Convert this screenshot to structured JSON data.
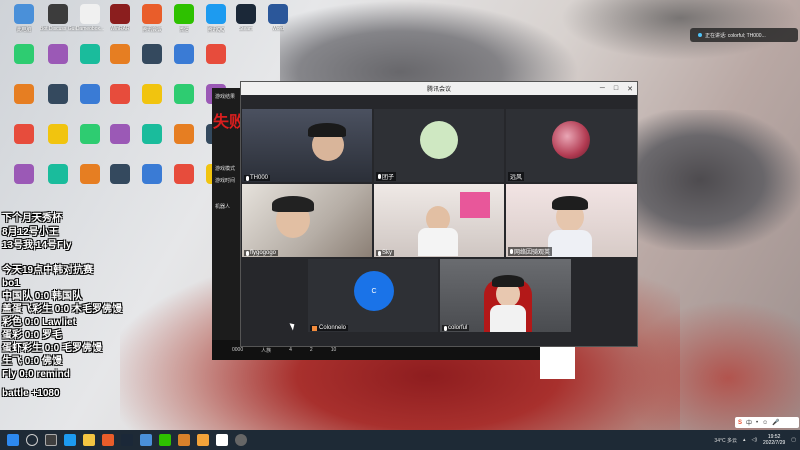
{
  "desktop_icons": [
    {
      "label": "此电脑",
      "color": "#4a90d9"
    },
    {
      "label": "Bot Discuss Guide...",
      "color": "#3c3c3c"
    },
    {
      "label": "Dameobox...",
      "color": "#f0f0f0"
    },
    {
      "label": "WinRAR",
      "color": "#8b1e1e"
    },
    {
      "label": "腾讯会议",
      "color": "#e95d2a"
    },
    {
      "label": "微信",
      "color": "#2ec100"
    },
    {
      "label": "腾讯QQ",
      "color": "#1d9bf0"
    },
    {
      "label": "Steam",
      "color": "#1b2838"
    },
    {
      "label": "Word",
      "color": "#2b579a"
    }
  ],
  "overlay": {
    "lines": [
      "下个月天秀杯",
      "8月12号小王",
      "13号我,14号Fly",
      "今天19点中韩对抗赛",
      "bo1",
      "中国队    0:0 韩国队",
      "盖蛋飞彩生 0:0 木毛罗佛馒",
      "彩色        0:0 Lawliet",
      "蛋彩        0:0 罗毛",
      "蛋虾彩生 0:0 毛罗佛馒",
      "生飞        0:0 佛馒",
      "Fly          0:0 remind",
      "battle +1080"
    ]
  },
  "game": {
    "fail_text": "失败",
    "side_items": [
      "游戏结果",
      "游戏模式",
      "游戏时间",
      "机器人"
    ],
    "bar_items": [
      "0000",
      "人族",
      "4",
      "2",
      "10"
    ]
  },
  "meeting": {
    "title": "腾讯会议",
    "controls": {
      "minimize": "─",
      "maximize": "□",
      "close": "✕"
    },
    "participants": [
      {
        "name": "TH000",
        "type": "video",
        "bg": "#3a3f4a"
      },
      {
        "name": "团子",
        "type": "avatar",
        "bg": "#cfe8c2"
      },
      {
        "name": "远风",
        "type": "avatar",
        "bg": "#b23b52"
      },
      {
        "name": "flygogogo",
        "type": "video",
        "bg": "#b9b4ad"
      },
      {
        "name": "Sky",
        "type": "video",
        "bg": "#d8d3d0"
      },
      {
        "name": "网络因骑观英",
        "type": "video",
        "bg": "#cfc7c2"
      },
      {
        "name": "Colonnelo",
        "type": "initial",
        "initial": "C",
        "bg": "#1a73e8"
      },
      {
        "name": "colorful",
        "type": "video",
        "bg": "#5f6165"
      }
    ]
  },
  "notification": {
    "text": "正在讲话: colorful; TH000..."
  },
  "ime": {
    "logo": "S",
    "items": [
      "中",
      "•",
      "☺",
      "🎤"
    ]
  },
  "taskbar": {
    "weather": "34°C 多云",
    "time": "19:52",
    "date": "2022/7/29"
  }
}
